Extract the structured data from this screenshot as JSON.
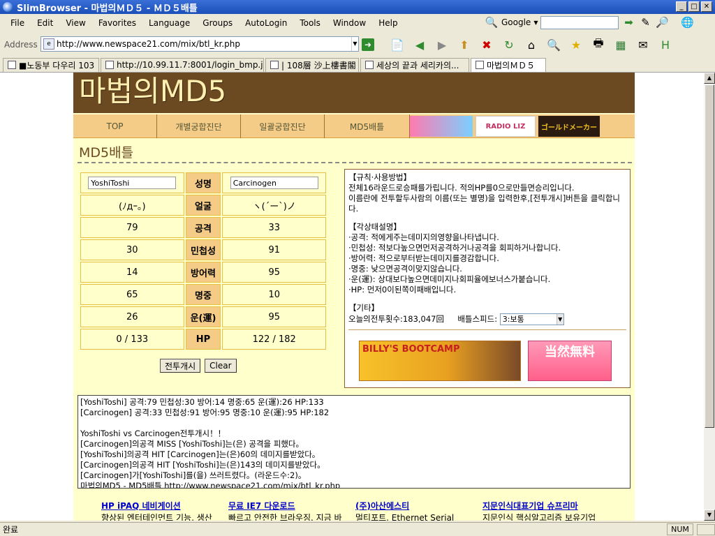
{
  "window": {
    "title": "SlimBrowser - 마법의ＭＤ５ - ＭＤ５배틀"
  },
  "menu": [
    "File",
    "Edit",
    "View",
    "Favorites",
    "Language",
    "Groups",
    "AutoLogin",
    "Tools",
    "Window",
    "Help"
  ],
  "search": {
    "engine": "Google",
    "value": ""
  },
  "address": {
    "label": "Address",
    "url": "http://www.newspace21.com/mix/btl_kr.php"
  },
  "tabs": [
    {
      "label": "■노동부 다우리 103"
    },
    {
      "label": "http://10.99.11.7:8001/login_bmp.jsp?u..."
    },
    {
      "label": "| 108層 沙上樓書閣"
    },
    {
      "label": "세상의 끝과 세리카의..."
    },
    {
      "label": "마법의ＭＤ５"
    }
  ],
  "site": {
    "logo": "마법의MD5",
    "nav": [
      "TOP",
      "개별궁합진단",
      "일괄궁합진단",
      "MD5배틀"
    ],
    "nav_banners": [
      "",
      "RADIO LIZ",
      "ゴールドメーカー"
    ],
    "page_title": "MD5배틀"
  },
  "battle": {
    "player1": "YoshiToshi",
    "player2": "Carcinogen",
    "rows": [
      {
        "label": "성명",
        "p1": "",
        "p2": ""
      },
      {
        "label": "얼굴",
        "p1": "(ﾉдｰ｡)",
        "p2": "ヽ(´ー`)ノ"
      },
      {
        "label": "공격",
        "p1": "79",
        "p2": "33"
      },
      {
        "label": "민첩성",
        "p1": "30",
        "p2": "91"
      },
      {
        "label": "방어력",
        "p1": "14",
        "p2": "95"
      },
      {
        "label": "명중",
        "p1": "65",
        "p2": "10"
      },
      {
        "label": "운(運)",
        "p1": "26",
        "p2": "95"
      },
      {
        "label": "HP",
        "p1": "0 / 133",
        "p2": "122 / 182"
      }
    ],
    "start_button": "전투개시",
    "clear_button": "Clear"
  },
  "rules": {
    "sec1_title": "【규칙·사용방법】",
    "sec1_l1": "전체16라운드로승패를가립니다. 적의HP를0으로만들면승리입니다.",
    "sec1_l2": "이름란에 전투할두사람의 이름(또는 별명)을 입력한후,[전투개시]버튼을 클릭합니다.",
    "sec2_title": "【각상태설명】",
    "sec2_items": [
      "·공격: 적에게주는데미지의영향을나타냅니다.",
      "·민첩성: 적보다높으면먼저공격하거나공격을 회피하거나합니다.",
      "·방어력: 적으로부터받는데미지를경감합니다.",
      "·명중: 낮으면공격이맞지않습니다.",
      "·운(運): 상대보다높으면데미지나회피율에보너스가붙습니다.",
      "·HP: 먼저0이된쪽이패배입니다."
    ],
    "sec3_title": "【기타】",
    "count_label": "오늘의전투횟수:183,047回",
    "speed_label": "배틀스피드:",
    "speed_value": "3:보통",
    "ad1_text": "BILLY'S BOOTCAMP",
    "ad2_text": "当然無料"
  },
  "log": {
    "lines1": [
      "[YoshiToshi] 공격:79 민첩성:30 방어:14 명중:65 운(運):26 HP:133",
      "[Carcinogen] 공격:33 민첩성:91 방어:95 명중:10 운(運):95 HP:182"
    ],
    "lines2": [
      "YoshiToshi vs Carcinogen전투개시！！",
      "[Carcinogen]의공격 MISS [YoshiToshi]는(은) 공격을 피했다。",
      "[YoshiToshi]의공격 HIT [Carcinogen]는(은)60의 데미지를받았다。",
      "[Carcinogen]의공격 HIT [YoshiToshi]는(은)143의 데미지를받았다。",
      "[Carcinogen]가[YoshiToshi]를(을) 쓰러트렸다。(라운드수:2)。",
      "마법의MD5 - MD5배틀 http://www.newspace21.com/mix/btl_kr.php"
    ]
  },
  "bottom_ads": [
    {
      "title": "HP iPAQ 네비게이션",
      "desc": "향상된 엔터테인먼트 기능, 생산"
    },
    {
      "title": "무료 IE7 다운로드",
      "desc": "빠르고 안전한 브라우징. 지금 바"
    },
    {
      "title": "(주)아산에스티",
      "desc": "멀티포트, Ethernet Serial"
    },
    {
      "title": "지문인식대표기업 슈프리마",
      "desc": "지문인식 핵심알고리즘 보유기업"
    }
  ],
  "status": {
    "text": "완료",
    "num": "NUM"
  }
}
